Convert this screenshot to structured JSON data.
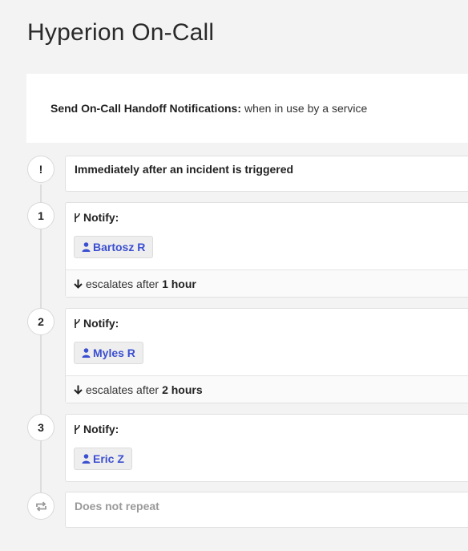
{
  "page": {
    "title": "Hyperion On-Call"
  },
  "handoff": {
    "label": "Send On-Call Handoff Notifications:",
    "value": "when in use by a service"
  },
  "trigger": {
    "node_label": "!",
    "text": "Immediately after an incident is triggered"
  },
  "rules": [
    {
      "number": "1",
      "notify_label": "Notify:",
      "target": "Bartosz R",
      "escalate_prefix": "escalates after",
      "escalate_duration": "1 hour"
    },
    {
      "number": "2",
      "notify_label": "Notify:",
      "target": "Myles R",
      "escalate_prefix": "escalates after",
      "escalate_duration": "2 hours"
    },
    {
      "number": "3",
      "notify_label": "Notify:",
      "target": "Eric Z"
    }
  ],
  "repeat": {
    "text": "Does not repeat",
    "icon": "repeat-icon"
  },
  "icons": {
    "notify": "branch-icon",
    "user": "user-icon",
    "escalate": "arrow-down-icon"
  },
  "colors": {
    "background": "#f3f3f3",
    "link": "#3b4fd1",
    "muted": "#9a9a9a"
  }
}
